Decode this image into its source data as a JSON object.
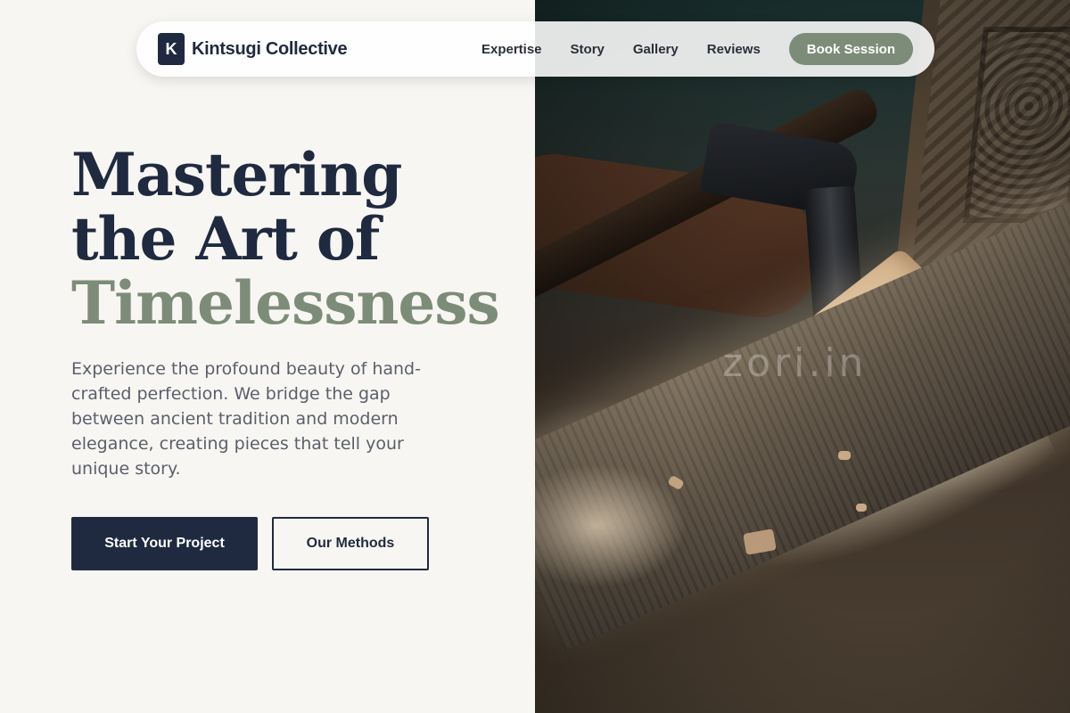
{
  "nav": {
    "brand_letter": "K",
    "brand_name": "Kintsugi Collective",
    "links": [
      "Expertise",
      "Story",
      "Gallery",
      "Reviews"
    ],
    "cta_label": "Book Session"
  },
  "hero": {
    "headline_line1": "Mastering",
    "headline_line2": "the Art of",
    "headline_line3": "Timelessness",
    "lead": "Experience the profound beauty of hand-crafted perfection. We bridge the gap between ancient tradition and modern elegance, creating pieces that tell your unique story.",
    "primary_cta": "Start Your Project",
    "secondary_cta": "Our Methods"
  },
  "image": {
    "watermark": "zori.in"
  },
  "colors": {
    "navy": "#1f2a40",
    "sage": "#7d8c78",
    "background": "#f8f6f2"
  }
}
